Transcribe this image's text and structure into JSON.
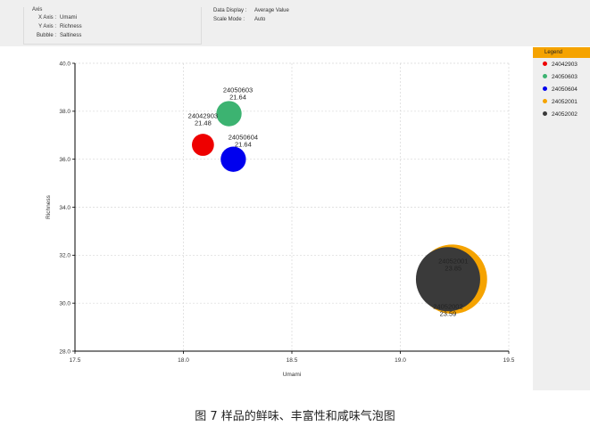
{
  "axis_panel": {
    "title": "Axis",
    "rows": [
      {
        "label": "X Axis :",
        "value": "Umami"
      },
      {
        "label": "Y Axis :",
        "value": "Richness"
      },
      {
        "label": "Bubble :",
        "value": "Saltiness"
      }
    ]
  },
  "display_panel": {
    "rows": [
      {
        "label": "Data Display :",
        "value": "Average Value"
      },
      {
        "label": "Scale Mode :",
        "value": "Auto"
      }
    ]
  },
  "legend": {
    "title": "Legend",
    "items": [
      {
        "name": "24042903",
        "color": "#ee0000"
      },
      {
        "name": "24050603",
        "color": "#3cb371"
      },
      {
        "name": "24050604",
        "color": "#0000ee"
      },
      {
        "name": "24052001",
        "color": "#f5a300"
      },
      {
        "name": "24052002",
        "color": "#3a3a3a"
      }
    ]
  },
  "chart_data": {
    "type": "bubble",
    "xlabel": "Umami",
    "ylabel": "Richness",
    "xlim": [
      17.5,
      19.5
    ],
    "ylim": [
      28.0,
      40.0
    ],
    "xticks": [
      "17.5",
      "18.0",
      "18.5",
      "19.0",
      "19.5"
    ],
    "yticks": [
      "28.0",
      "30.0",
      "32.0",
      "34.0",
      "36.0",
      "38.0",
      "40.0"
    ],
    "grid": true,
    "series": [
      {
        "name": "24052001",
        "x": 19.24,
        "y": 31.0,
        "bubble": 23.85,
        "color": "#f5a300",
        "label": "24052001",
        "value_label": "23.85"
      },
      {
        "name": "24052002",
        "x": 19.22,
        "y": 31.0,
        "bubble": 23.59,
        "color": "#3a3a3a",
        "label": "24052002",
        "value_label": "23.59"
      },
      {
        "name": "24042903",
        "x": 18.09,
        "y": 36.6,
        "bubble": 21.48,
        "color": "#ee0000",
        "label": "24042903",
        "value_label": "21.48"
      },
      {
        "name": "24050603",
        "x": 18.21,
        "y": 37.9,
        "bubble": 21.64,
        "color": "#3cb371",
        "label": "24050603",
        "value_label": "21.64"
      },
      {
        "name": "24050604",
        "x": 18.23,
        "y": 36.0,
        "bubble": 21.64,
        "color": "#0000ee",
        "label": "24050604",
        "value_label": "21.64"
      }
    ]
  },
  "caption": "图 7  样品的鲜味、丰富性和咸味气泡图"
}
